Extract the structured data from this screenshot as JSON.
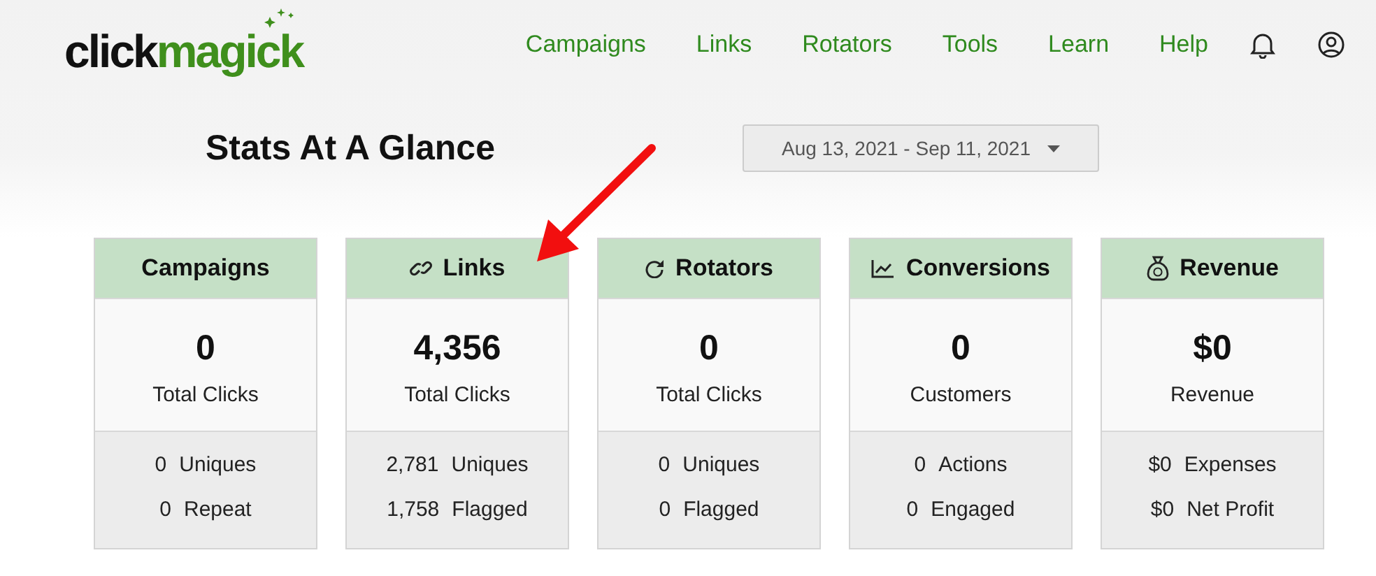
{
  "logo": {
    "dark": "click",
    "accent": "magick"
  },
  "nav": [
    "Campaigns",
    "Links",
    "Rotators",
    "Tools",
    "Learn",
    "Help"
  ],
  "title": "Stats At A Glance",
  "date_range": "Aug 13, 2021 - Sep 11, 2021",
  "cards": [
    {
      "kind": "plain",
      "title": "Campaigns",
      "value": "0",
      "value_label": "Total Clicks",
      "stats": [
        {
          "value": "0",
          "label": "Uniques"
        },
        {
          "value": "0",
          "label": "Repeat"
        }
      ]
    },
    {
      "kind": "links",
      "title": "Links",
      "value": "4,356",
      "value_label": "Total Clicks",
      "stats": [
        {
          "value": "2,781",
          "label": "Uniques"
        },
        {
          "value": "1,758",
          "label": "Flagged"
        }
      ]
    },
    {
      "kind": "rotators",
      "title": "Rotators",
      "value": "0",
      "value_label": "Total Clicks",
      "stats": [
        {
          "value": "0",
          "label": "Uniques"
        },
        {
          "value": "0",
          "label": "Flagged"
        }
      ]
    },
    {
      "kind": "conversions",
      "title": "Conversions",
      "value": "0",
      "value_label": "Customers",
      "stats": [
        {
          "value": "0",
          "label": "Actions"
        },
        {
          "value": "0",
          "label": "Engaged"
        }
      ]
    },
    {
      "kind": "revenue",
      "title": "Revenue",
      "value": "$0",
      "value_label": "Revenue",
      "stats": [
        {
          "value": "$0",
          "label": "Expenses"
        },
        {
          "value": "$0",
          "label": "Net Profit"
        }
      ]
    }
  ]
}
